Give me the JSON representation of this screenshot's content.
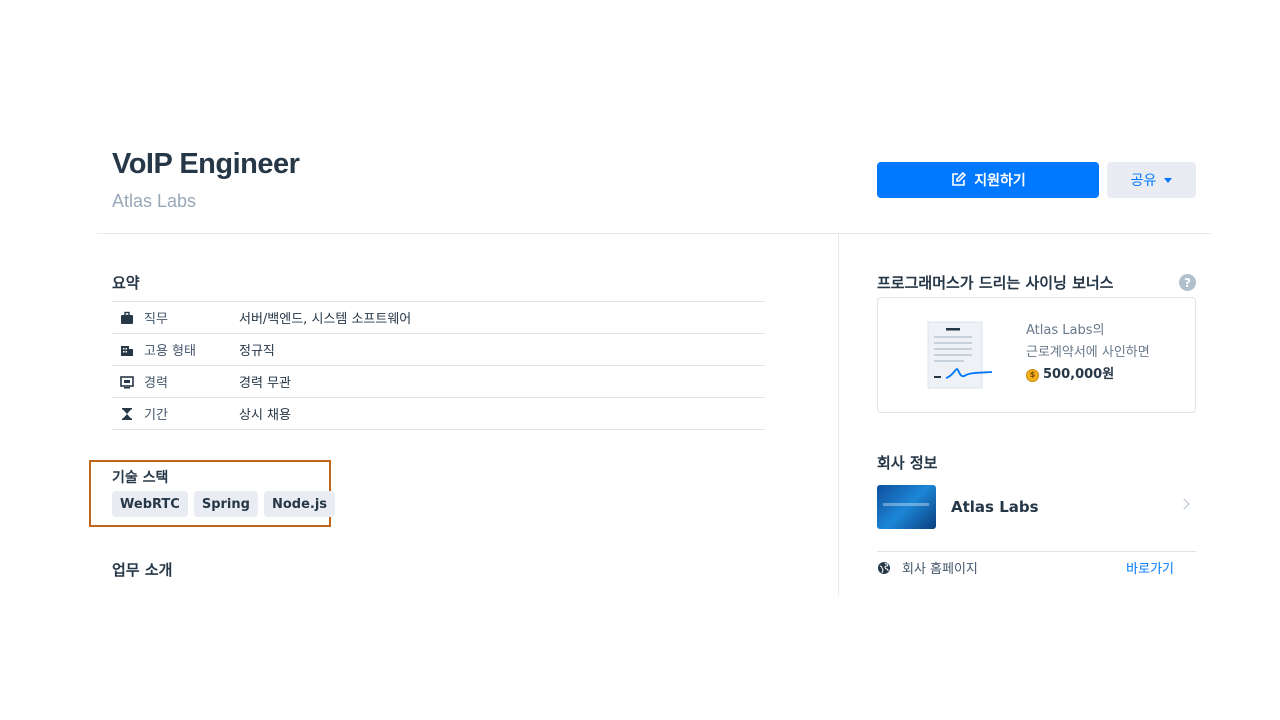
{
  "job": {
    "title": "VoIP Engineer",
    "company": "Atlas Labs"
  },
  "actions": {
    "apply_label": "지원하기",
    "share_label": "공유"
  },
  "summary": {
    "title": "요약",
    "rows": [
      {
        "icon": "briefcase-icon",
        "label": "직무",
        "value": "서버/백엔드, 시스템 소프트웨어"
      },
      {
        "icon": "building-icon",
        "label": "고용 형태",
        "value": "정규직"
      },
      {
        "icon": "monitor-icon",
        "label": "경력",
        "value": "경력 무관"
      },
      {
        "icon": "hourglass-icon",
        "label": "기간",
        "value": "상시 채용"
      }
    ]
  },
  "tech_stack": {
    "title": "기술 스택",
    "tags": [
      "WebRTC",
      "Spring",
      "Node.js"
    ]
  },
  "intro": {
    "title": "업무 소개"
  },
  "bonus": {
    "title": "프로그래머스가 드리는 사이닝 보너스",
    "line1": "Atlas Labs의",
    "line2": "근로계약서에 사인하면",
    "amount": "500,000원"
  },
  "company_info": {
    "title": "회사 정보",
    "name": "Atlas Labs",
    "homepage_label": "회사 홈페이지",
    "homepage_link": "바로가기"
  },
  "colors": {
    "primary": "#0078ff",
    "text": "#263747",
    "muted": "#98a8b9",
    "highlight_border": "#c0661b"
  }
}
